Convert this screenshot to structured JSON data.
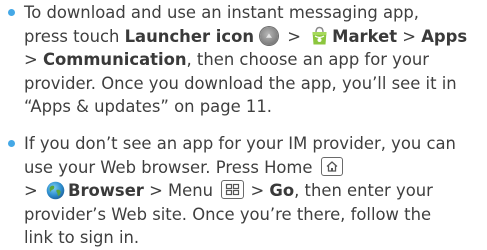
{
  "bullet_color": "#45a8e6",
  "item1": {
    "line1": "To download and use an instant messaging app,",
    "line2_a": "press touch ",
    "line2_launcher": "Launcher icon",
    "line2_gt1": " > ",
    "line2_market": "Market",
    "line2_gt2": " > ",
    "line2_apps": "Apps",
    "line3_gt": "> ",
    "line3_comm": "Communication",
    "line3_rest": ", then choose an app for your",
    "line4": "provider. Once you download the app, you’ll see it in",
    "line5": "“Apps & updates” on page 11.",
    "icons": [
      "launcher-icon",
      "market-icon"
    ]
  },
  "item2": {
    "line1": "If you don’t see an app for your IM provider, you can",
    "line2": "use your Web browser. Press Home ",
    "line3_gt1": "> ",
    "line3_browser": "Browser",
    "line3_gt2": " > Menu ",
    "line3_gt3": " > ",
    "line3_go": "Go",
    "line3_rest": ", then enter your",
    "line4": "provider’s Web site. Once you’re there, follow the",
    "line5": "link to sign in.",
    "icons": [
      "home-key-icon",
      "browser-icon",
      "menu-key-icon"
    ]
  }
}
